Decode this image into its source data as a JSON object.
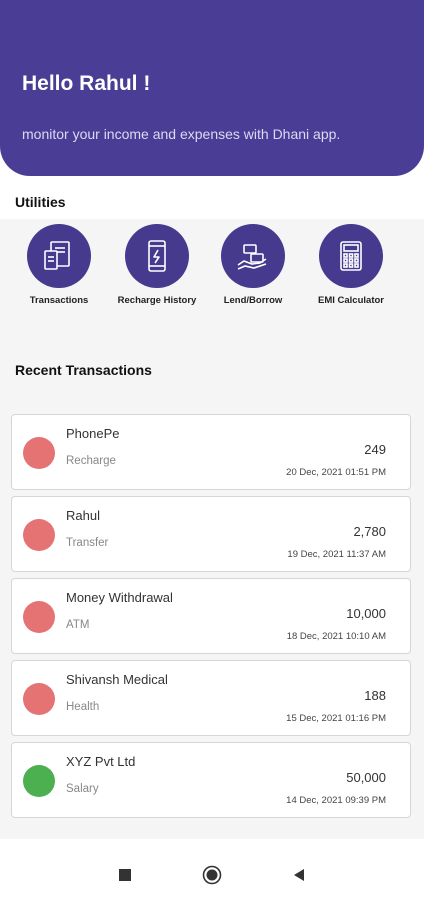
{
  "header": {
    "greeting": "Hello Rahul !",
    "subtitle": "monitor your income and expenses with Dhani app."
  },
  "utilities": {
    "title": "Utilities",
    "items": [
      {
        "label": "Transactions",
        "icon": "transactions-icon"
      },
      {
        "label": "Recharge History",
        "icon": "phone-recharge-icon"
      },
      {
        "label": "Lend/Borrow",
        "icon": "lend-borrow-icon"
      },
      {
        "label": "EMI Calculator",
        "icon": "calculator-icon"
      }
    ]
  },
  "recent": {
    "title": "Recent Transactions",
    "items": [
      {
        "name": "PhonePe",
        "category": "Recharge",
        "amount": "249",
        "date": "20 Dec, 2021 01:51 PM",
        "color": "#e57373"
      },
      {
        "name": "Rahul",
        "category": "Transfer",
        "amount": "2,780",
        "date": "19 Dec, 2021 11:37 AM",
        "color": "#e57373"
      },
      {
        "name": "Money Withdrawal",
        "category": "ATM",
        "amount": "10,000",
        "date": "18 Dec, 2021 10:10 AM",
        "color": "#e57373"
      },
      {
        "name": "Shivansh Medical",
        "category": "Health",
        "amount": "188",
        "date": "15 Dec, 2021 01:16 PM",
        "color": "#e57373"
      },
      {
        "name": "XYZ Pvt Ltd",
        "category": "Salary",
        "amount": "50,000",
        "date": "14 Dec, 2021 09:39 PM",
        "color": "#4caf50"
      }
    ]
  },
  "navbar": {
    "buttons": [
      {
        "icon": "square-recents-icon"
      },
      {
        "icon": "circle-home-icon"
      },
      {
        "icon": "triangle-back-icon"
      }
    ]
  }
}
